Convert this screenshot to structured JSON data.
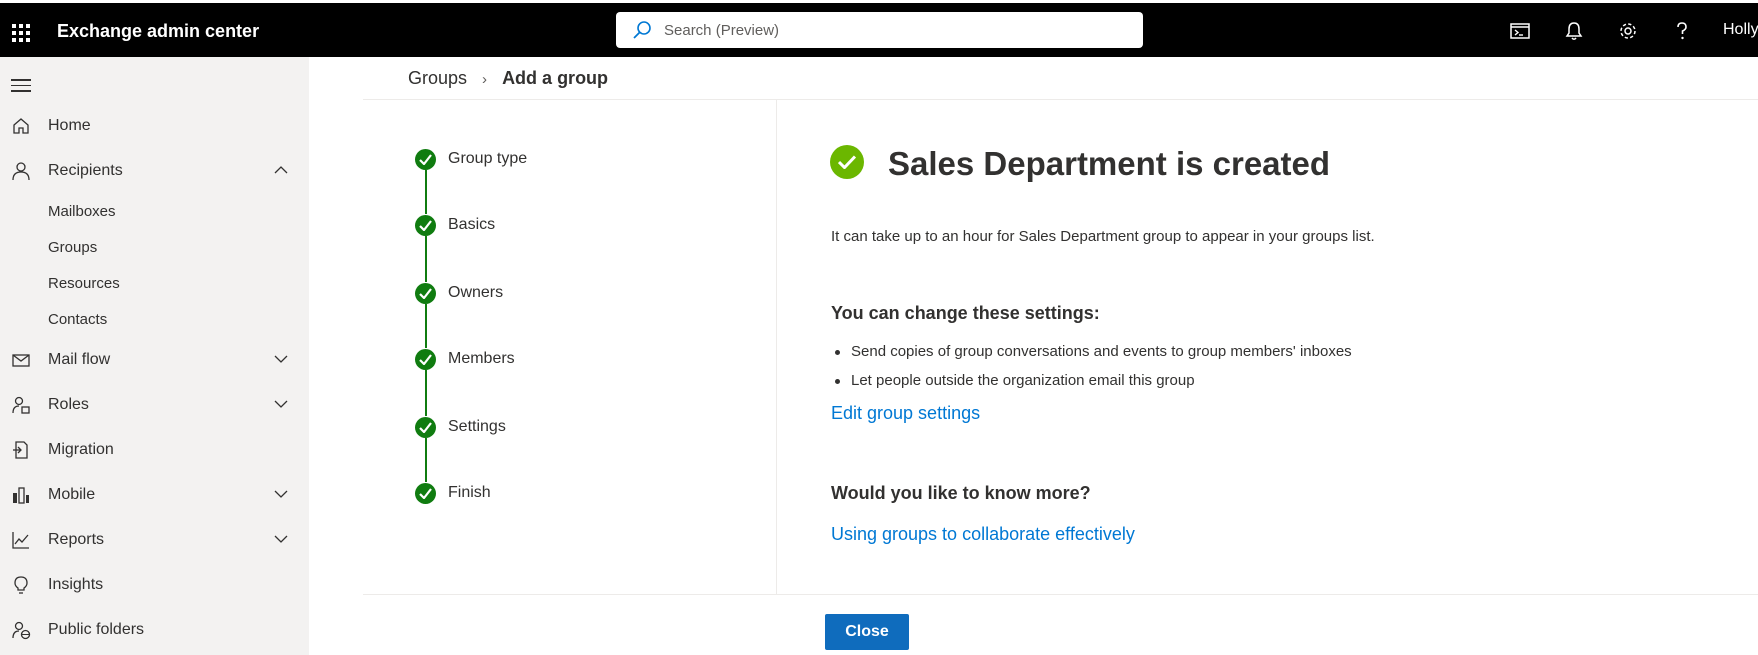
{
  "header": {
    "app_title": "Exchange admin center",
    "search_placeholder": "Search (Preview)",
    "user": "Holly"
  },
  "sidebar": {
    "items": [
      {
        "label": "Home",
        "icon": "home-icon"
      },
      {
        "label": "Recipients",
        "icon": "person-icon",
        "expanded": true
      },
      {
        "label": "Mail flow",
        "icon": "mail-icon",
        "expanded": false
      },
      {
        "label": "Roles",
        "icon": "roles-icon",
        "expanded": false
      },
      {
        "label": "Migration",
        "icon": "migration-icon"
      },
      {
        "label": "Mobile",
        "icon": "mobile-icon",
        "expanded": false
      },
      {
        "label": "Reports",
        "icon": "reports-icon",
        "expanded": false
      },
      {
        "label": "Insights",
        "icon": "lightbulb-icon"
      },
      {
        "label": "Public folders",
        "icon": "public-folders-icon"
      }
    ],
    "recipients_sub": [
      "Mailboxes",
      "Groups",
      "Resources",
      "Contacts"
    ]
  },
  "breadcrumb": {
    "parent": "Groups",
    "current": "Add a group"
  },
  "wizard": {
    "steps": [
      "Group type",
      "Basics",
      "Owners",
      "Members",
      "Settings",
      "Finish"
    ]
  },
  "main": {
    "headline": "Sales Department is created",
    "info": "It can take up to an hour for  Sales Department group to appear in your groups list.",
    "settings_title": "You can change these settings:",
    "settings_items": [
      "Send copies of group conversations and events to group members' inboxes",
      "Let people outside the organization email this group"
    ],
    "edit_link": "Edit group settings",
    "more_title": "Would you like to know more?",
    "more_link": "Using groups to collaborate effectively"
  },
  "footer": {
    "close_label": "Close"
  },
  "colors": {
    "accent": "#0078d4",
    "success": "#6bb700",
    "step_complete": "#107c10"
  }
}
